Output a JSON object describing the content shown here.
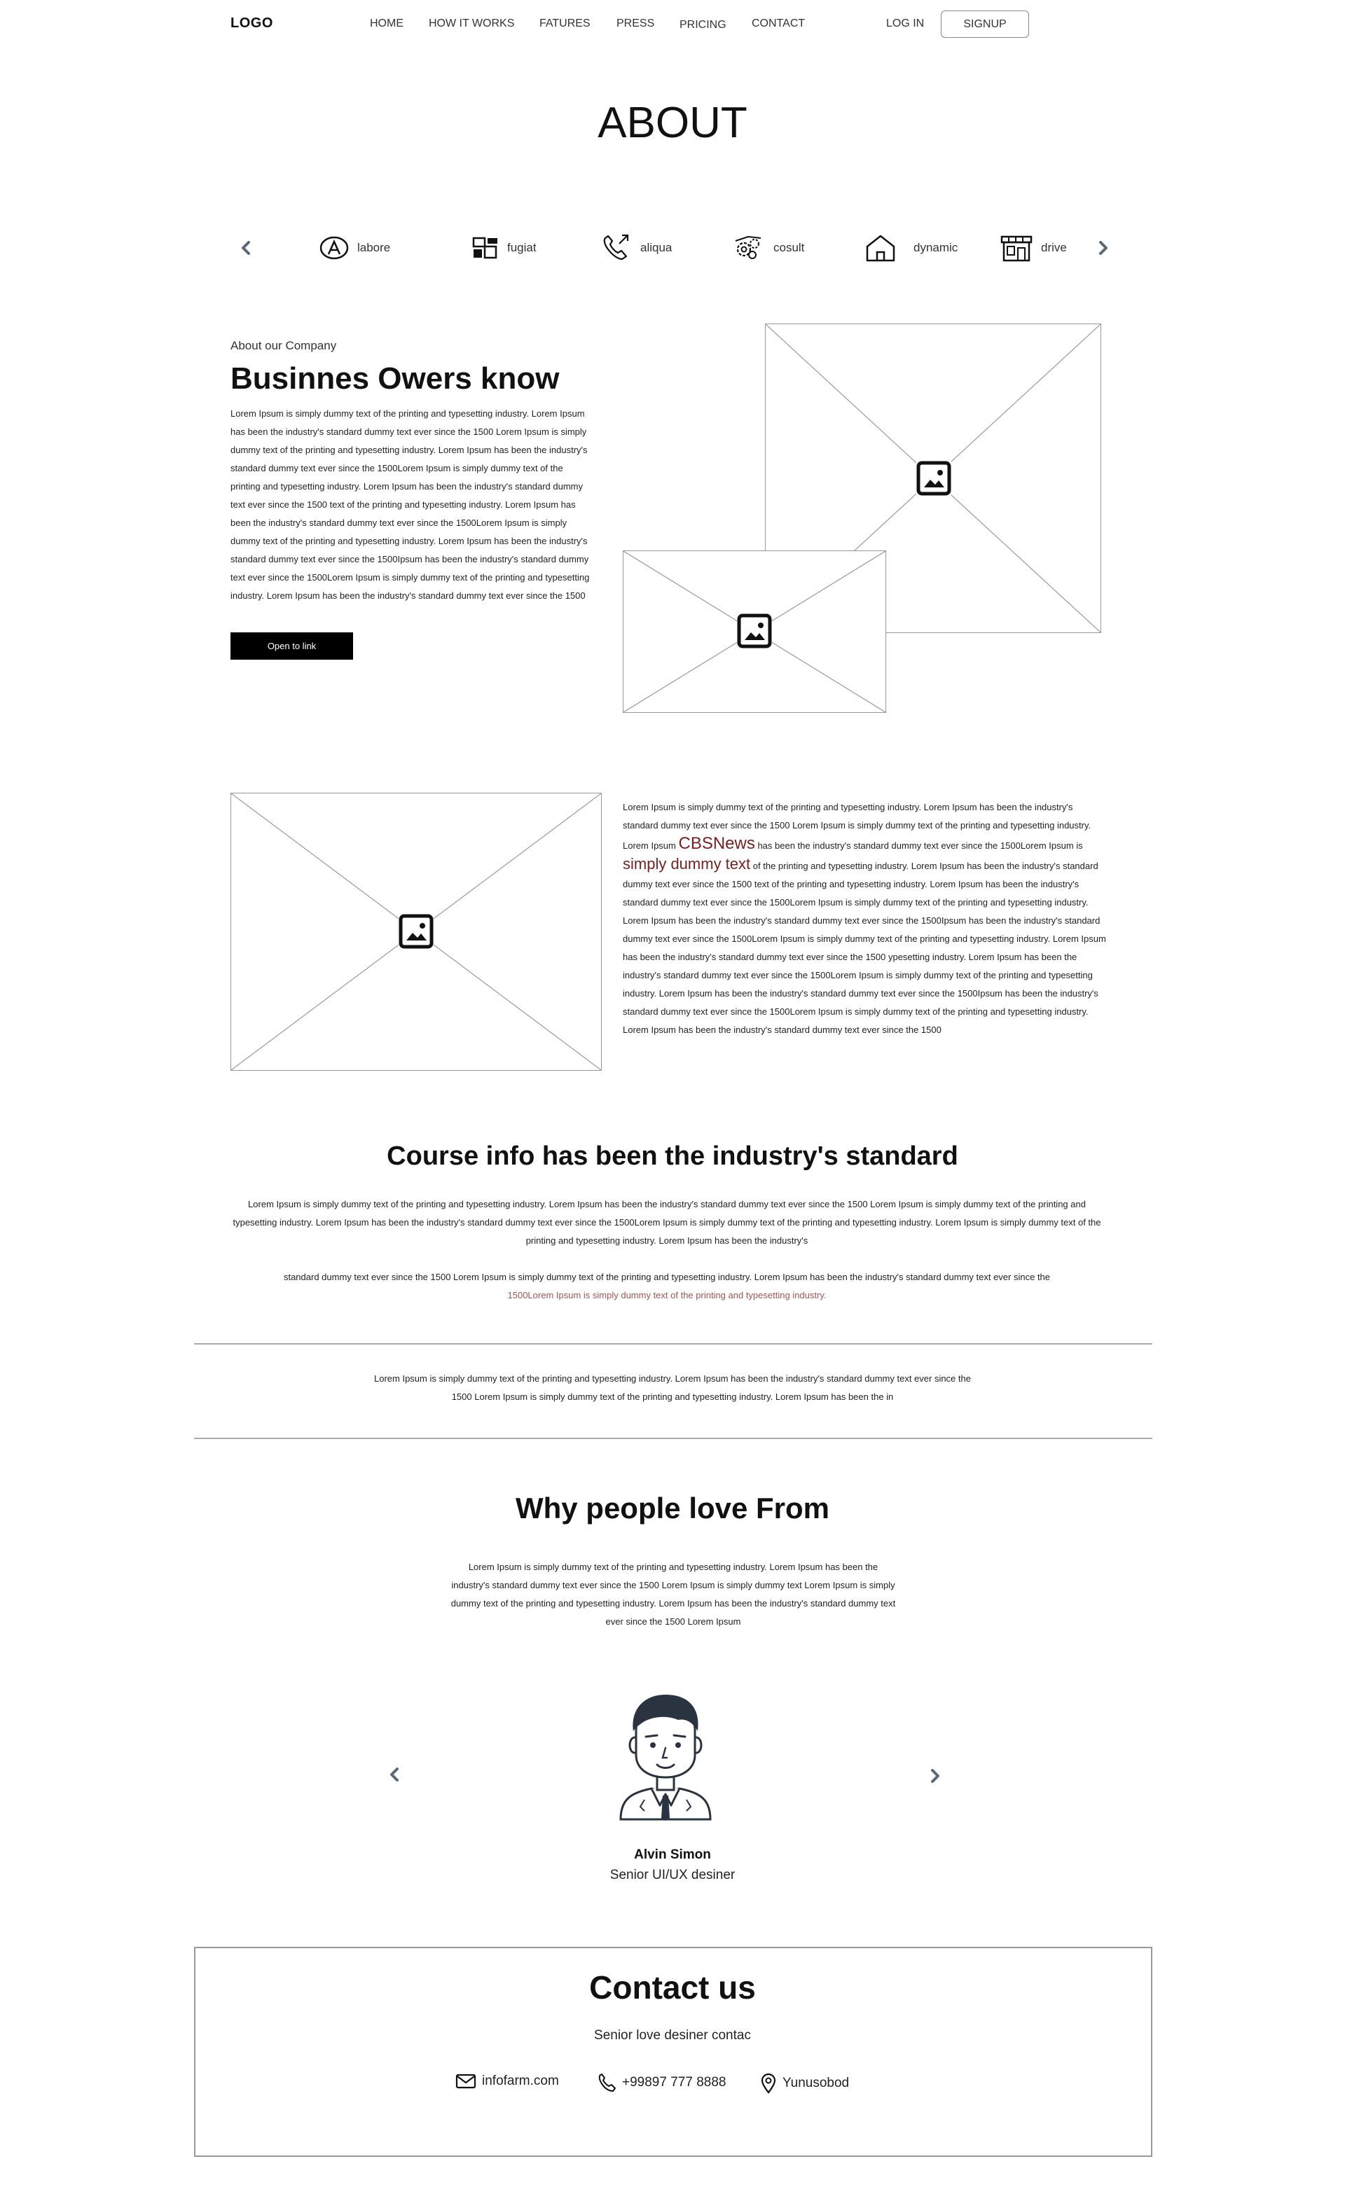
{
  "nav": {
    "logo": "LOGO",
    "links": [
      "HOME",
      "HOW IT WORKS",
      "FATURES",
      "PRESS",
      "PRICING",
      "CONTACT"
    ],
    "login": "LOG IN",
    "signup": "SIGNUP"
  },
  "page_title": "ABOUT",
  "categories": {
    "items": [
      {
        "label": "labore",
        "icon": "letter-a-circle-icon"
      },
      {
        "label": "fugiat",
        "icon": "blocks-icon"
      },
      {
        "label": "aliqua",
        "icon": "phone-outgoing-icon"
      },
      {
        "label": "cosult",
        "icon": "gears-icon"
      },
      {
        "label": "dynamic",
        "icon": "home-icon"
      },
      {
        "label": "drive",
        "icon": "store-icon"
      }
    ]
  },
  "company": {
    "eyebrow": "About our Company",
    "heading": "Businnes Owers know",
    "body": "Lorem Ipsum is simply dummy text of the printing and typesetting industry. Lorem Ipsum has been the industry's standard dummy text ever since the 1500 Lorem Ipsum is simply dummy text of the printing and typesetting industry. Lorem Ipsum has been the industry's standard dummy text ever since the 1500Lorem Ipsum is simply dummy text of the printing and typesetting industry. Lorem Ipsum has been the industry's standard dummy text ever since the 1500 text of the printing and typesetting industry. Lorem Ipsum has been the industry's standard dummy text ever since the 1500Lorem Ipsum is simply dummy text of the printing and typesetting industry. Lorem Ipsum has been the industry's standard dummy text ever since the 1500Ipsum has been the industry's standard dummy text ever since the 1500Lorem Ipsum is simply dummy text of the printing and typesetting industry. Lorem Ipsum has been the industry's standard dummy text ever since the 1500",
    "button": "Open to link"
  },
  "feature": {
    "part1": "Lorem Ipsum is simply dummy text of the printing and typesetting industry. Lorem Ipsum has been the industry's standard dummy text ever since the 1500 Lorem Ipsum is simply dummy text of the printing and typesetting industry. Lorem Ipsum ",
    "highlight1": "CBSNews",
    "part2": " has been the industry's standard dummy text ever since the 1500Lorem Ipsum is ",
    "highlight2": "simply dummy text",
    "part3": " of the printing and typesetting industry. Lorem Ipsum has been the industry's standard dummy text ever since the 1500 text of the printing and typesetting industry. Lorem Ipsum has been the industry's standard dummy text ever since the 1500Lorem Ipsum is simply dummy text of the printing and typesetting industry. Lorem Ipsum has been the industry's standard dummy text ever since the 1500Ipsum has been the industry's standard dummy text ever since the 1500Lorem Ipsum is simply dummy text of the printing and typesetting industry. Lorem Ipsum has been the industry's standard dummy text ever since the 1500 ypesetting industry. Lorem Ipsum has been the industry's standard dummy text ever since the 1500Lorem Ipsum is simply dummy text of the printing and typesetting industry. Lorem Ipsum has been the industry's standard dummy text ever since the 1500Ipsum has been the industry's standard dummy text ever since the 1500Lorem Ipsum is simply dummy text of the printing and typesetting industry. Lorem Ipsum has been the industry's standard dummy text ever since the 1500"
  },
  "course": {
    "heading": "Course info has been the industry's standard",
    "para1": "Lorem Ipsum is simply dummy text of the printing and typesetting industry. Lorem Ipsum has been the industry's standard dummy text ever since the 1500 Lorem Ipsum is simply dummy text of the printing and typesetting industry. Lorem Ipsum has been the industry's standard dummy text ever since the 1500Lorem Ipsum is simply dummy text of the printing and typesetting industry. Lorem Ipsum is simply dummy text of the printing and typesetting industry. Lorem Ipsum has been the industry's",
    "para2": "standard dummy text ever since the 1500 Lorem Ipsum is simply dummy text of the printing and typesetting industry. Lorem Ipsum has been the industry's standard dummy text ever since the",
    "para2_highlight": "1500Lorem Ipsum is simply dummy text of the printing and typesetting industry."
  },
  "divider_text": "Lorem Ipsum is simply dummy text of the printing and typesetting industry. Lorem Ipsum has been the industry's standard dummy text ever since the 1500 Lorem Ipsum is simply dummy text of the printing and typesetting industry. Lorem Ipsum has been the in",
  "why": {
    "heading": "Why people love From",
    "body": "Lorem Ipsum is simply dummy text of the printing and typesetting industry. Lorem Ipsum has been the industry's standard dummy text ever since the 1500 Lorem Ipsum is simply dummy text Lorem Ipsum is simply dummy text of the printing and typesetting industry. Lorem Ipsum has been the industry's standard dummy text ever since the 1500 Lorem Ipsum"
  },
  "testimonial": {
    "name": "Alvin Simon",
    "role": "Senior UI/UX desiner"
  },
  "contact": {
    "title": "Contact us",
    "subtitle": "Senior love desiner contac",
    "email": "infofarm.com",
    "phone": "+99897 777 8888",
    "location": "Yunusobod"
  },
  "colors": {
    "accent_red": "#7a1f1f",
    "arrow": "#5a6a7a"
  }
}
